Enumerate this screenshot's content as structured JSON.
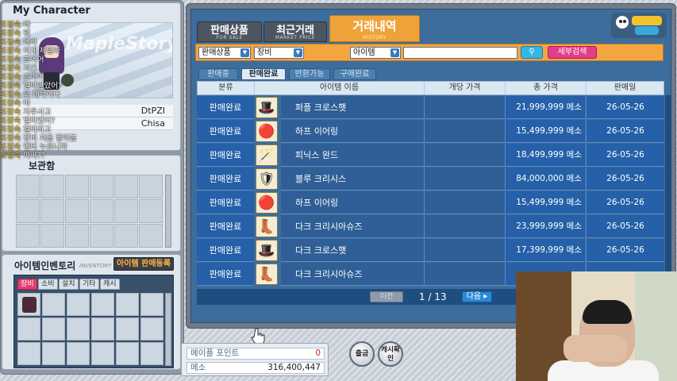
{
  "character": {
    "title": "My Character",
    "scene_watermark": "MapleStory",
    "fame_rows": [
      {
        "label": "",
        "value": "DtPZI"
      },
      {
        "label": "",
        "value": "Chisa"
      }
    ],
    "chat": [
      {
        "who": "조정숙",
        "text": "에"
      },
      {
        "who": "조정숙",
        "text": "웨"
      },
      {
        "who": "조정숙",
        "text": "에라"
      },
      {
        "who": "조정숙",
        "text": "이게 제일싸"
      },
      {
        "who": "조정숙",
        "text": "흐어어"
      },
      {
        "who": "조정숙",
        "text": "저긴"
      },
      {
        "who": "조정숙",
        "text": "흐어어"
      },
      {
        "who": "조정숙",
        "text": "얼마받았어?"
      },
      {
        "who": "조정숙",
        "text": "와 대박이다"
      },
      {
        "who": "조정숙",
        "text": "아"
      },
      {
        "who": "조정숙",
        "text": "자투사고"
      },
      {
        "who": "조정숙",
        "text": "얼마였어?"
      },
      {
        "who": "조정숙",
        "text": "얼마라고"
      },
      {
        "who": "조정숙",
        "text": "장비 처음 팔아봄"
      },
      {
        "who": "조정숙",
        "text": "엔터 누르니까"
      },
      {
        "who": "조정숙",
        "text": "아싸??"
      }
    ]
  },
  "equip": {
    "title": "보관함"
  },
  "inventory": {
    "title": "아이템인벤토리",
    "subtitle": "INVENTORY",
    "register_button": "아이템 판매등록",
    "tabs": [
      "장비",
      "소비",
      "설치",
      "기타",
      "캐시"
    ]
  },
  "top_tabs": [
    {
      "label": "판매상품",
      "sub": "FOR SALE",
      "active": false
    },
    {
      "label": "최근거래",
      "sub": "MARKET PRICE",
      "active": false
    },
    {
      "label": "거래내역",
      "sub": "HISTORY",
      "active": true
    }
  ],
  "filters": {
    "category": "판매상품",
    "type": "장비",
    "search_by": "아이템",
    "search_value": "",
    "search_button": "검색",
    "detail_button": "세부검색"
  },
  "sub_tabs": [
    "판매중",
    "판매완료",
    "반환가능",
    "구매완료"
  ],
  "table": {
    "headers": [
      "분류",
      "아이템 이름",
      "개당 가격",
      "총 가격",
      "판매일"
    ],
    "rows": [
      {
        "status": "판매완료",
        "icon": "purple-cross-hat-icon",
        "name": "퍼플 크로스햇",
        "unit_price": "",
        "total": "21,999,999 메소",
        "date": "26-05-26"
      },
      {
        "status": "판매완료",
        "icon": "harp-earring-icon",
        "name": "하프 이어링",
        "unit_price": "",
        "total": "15,499,999 메소",
        "date": "26-05-26"
      },
      {
        "status": "판매완료",
        "icon": "phoenix-wand-icon",
        "name": "피닉스 완드",
        "unit_price": "",
        "total": "18,499,999 메소",
        "date": "26-05-26"
      },
      {
        "status": "판매완료",
        "icon": "blue-crisis-icon",
        "name": "블루 크리시스",
        "unit_price": "",
        "total": "84,000,000 메소",
        "date": "26-05-26"
      },
      {
        "status": "판매완료",
        "icon": "harp-earring-icon",
        "name": "하프 이어링",
        "unit_price": "",
        "total": "15,499,999 메소",
        "date": "26-05-26"
      },
      {
        "status": "판매완료",
        "icon": "dark-crisia-shoes-icon",
        "name": "다크 크리시아슈즈",
        "unit_price": "",
        "total": "23,999,999 메소",
        "date": "26-05-26"
      },
      {
        "status": "판매완료",
        "icon": "dark-cross-hat-icon",
        "name": "다크 크로스햇",
        "unit_price": "",
        "total": "17,399,999 메소",
        "date": "26-05-26"
      },
      {
        "status": "판매완료",
        "icon": "dark-crisia-shoes-icon",
        "name": "다크 크리시아슈즈",
        "unit_price": "",
        "total": "",
        "date": ""
      }
    ]
  },
  "pager": {
    "prev": "이전",
    "current": "1 / 13",
    "next": "다음 ▸"
  },
  "points": {
    "maple_label": "메이플 포인트",
    "maple_value": "0",
    "meso_label": "메소",
    "meso_value": "316,400,447"
  },
  "bottom_buttons": {
    "withdraw": "출금",
    "cash_confirm": "캐시확인"
  },
  "colors": {
    "accent_orange": "#f0a23a",
    "table_blue": "#2560a8",
    "pink": "#e23e8a"
  }
}
